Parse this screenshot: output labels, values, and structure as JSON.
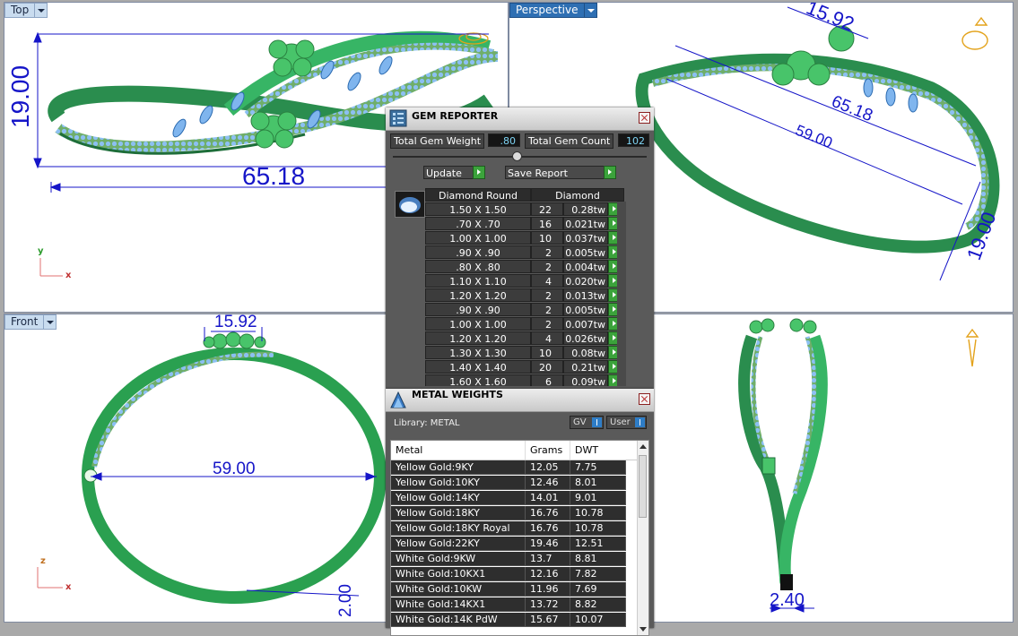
{
  "viewports": {
    "top": {
      "label": "Top",
      "dim_width": "65.18",
      "dim_height": "19.00",
      "axis_y": "y",
      "axis_x": "x"
    },
    "perspective": {
      "label": "Perspective",
      "dim_a": "15.92",
      "dim_b": "65.18",
      "dim_c": "59.00",
      "dim_d": "19.00"
    },
    "front": {
      "label": "Front",
      "dim_top": "15.92",
      "dim_diam": "59.00",
      "dim_thick": "2.00",
      "axis_z": "z",
      "axis_x": "x"
    },
    "right": {
      "dim_bottom": "2.40"
    }
  },
  "gem_reporter": {
    "title": "GEM REPORTER",
    "total_weight_label": "Total Gem Weight",
    "total_weight_value": ".80",
    "total_count_label": "Total Gem Count",
    "total_count_value": "102",
    "update_label": "Update",
    "save_label": "Save Report",
    "col_shape": "Diamond Round",
    "col_material": "Diamond",
    "rows": [
      {
        "size": "1.50 X 1.50",
        "count": "22",
        "weight": "0.28tw"
      },
      {
        "size": ".70 X .70",
        "count": "16",
        "weight": "0.021tw"
      },
      {
        "size": "1.00 X 1.00",
        "count": "10",
        "weight": "0.037tw"
      },
      {
        "size": ".90 X .90",
        "count": "2",
        "weight": "0.005tw"
      },
      {
        "size": ".80 X .80",
        "count": "2",
        "weight": "0.004tw"
      },
      {
        "size": "1.10 X 1.10",
        "count": "4",
        "weight": "0.020tw"
      },
      {
        "size": "1.20 X 1.20",
        "count": "2",
        "weight": "0.013tw"
      },
      {
        "size": ".90 X .90",
        "count": "2",
        "weight": "0.005tw"
      },
      {
        "size": "1.00 X 1.00",
        "count": "2",
        "weight": "0.007tw"
      },
      {
        "size": "1.20 X 1.20",
        "count": "4",
        "weight": "0.026tw"
      },
      {
        "size": "1.30 X 1.30",
        "count": "10",
        "weight": "0.08tw"
      },
      {
        "size": "1.40 X 1.40",
        "count": "20",
        "weight": "0.21tw"
      },
      {
        "size": "1.60 X 1.60",
        "count": "6",
        "weight": "0.09tw"
      }
    ]
  },
  "metal_weights": {
    "title": "METAL WEIGHTS",
    "library": "Library: METAL",
    "gv_label": "GV",
    "user_label": "User",
    "col_metal": "Metal",
    "col_grams": "Grams",
    "col_dwt": "DWT",
    "rows": [
      {
        "metal": "Yellow Gold:9KY",
        "grams": "12.05",
        "dwt": "7.75"
      },
      {
        "metal": "Yellow Gold:10KY",
        "grams": "12.46",
        "dwt": "8.01"
      },
      {
        "metal": "Yellow Gold:14KY",
        "grams": "14.01",
        "dwt": "9.01"
      },
      {
        "metal": "Yellow Gold:18KY",
        "grams": "16.76",
        "dwt": "10.78"
      },
      {
        "metal": "Yellow Gold:18KY Royal",
        "grams": "16.76",
        "dwt": "10.78"
      },
      {
        "metal": "Yellow Gold:22KY",
        "grams": "19.46",
        "dwt": "12.51"
      },
      {
        "metal": "White Gold:9KW",
        "grams": "13.7",
        "dwt": "8.81"
      },
      {
        "metal": "White Gold:10KX1",
        "grams": "12.16",
        "dwt": "7.82"
      },
      {
        "metal": "White Gold:10KW",
        "grams": "11.96",
        "dwt": "7.69"
      },
      {
        "metal": "White Gold:14KX1",
        "grams": "13.72",
        "dwt": "8.82"
      },
      {
        "metal": "White Gold:14K PdW",
        "grams": "15.67",
        "dwt": "10.07"
      }
    ]
  },
  "colors": {
    "dimension": "#1515c8",
    "metal": "#2aa050",
    "gem": "#7fb5ee",
    "accent": "#3ba33b"
  }
}
